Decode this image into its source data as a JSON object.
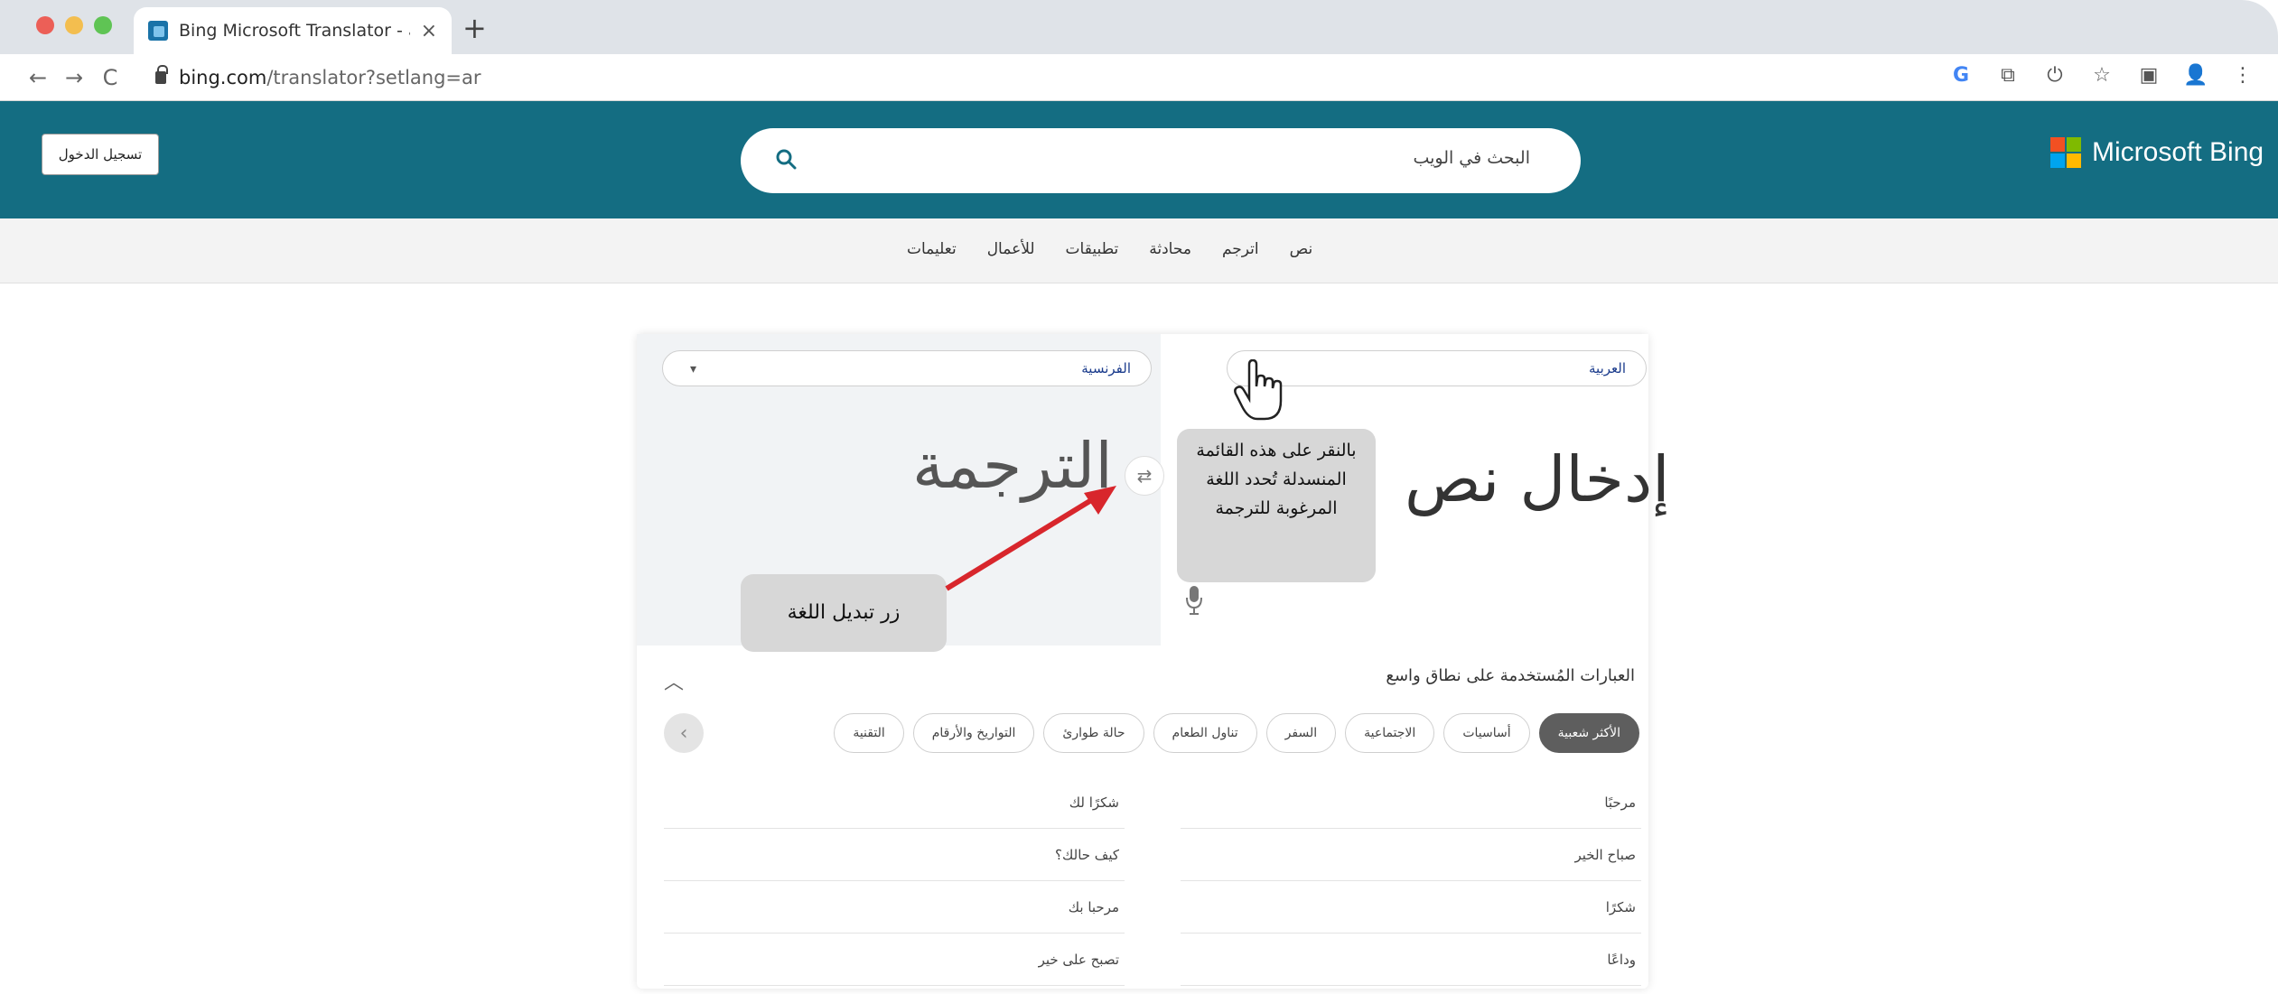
{
  "browser": {
    "tab_title": "Bing Microsoft Translator - عربية",
    "tab_close": "×",
    "new_tab": "+",
    "url_host": "bing.com",
    "url_rest": "/translator?setlang=ar",
    "nav": {
      "back": "←",
      "forward": "→",
      "reload": "C"
    },
    "toolbar_icons": [
      "G",
      "⧉",
      "⏻",
      "☆",
      "▣",
      "👤",
      "⋮"
    ]
  },
  "header": {
    "signin_label": "تسجيل الدخول",
    "search_placeholder": "البحث في الويب",
    "brand_name": "Microsoft Bing",
    "brand_colors": [
      "#f25022",
      "#7fba00",
      "#00a4ef",
      "#ffb900"
    ],
    "accent_color": "#146d82"
  },
  "subnav": {
    "items": [
      "نص",
      "اترجم",
      "محادثة",
      "تطبيقات",
      "للأعمال",
      "تعليمات"
    ]
  },
  "translator": {
    "source_lang": "العربية",
    "target_lang": "الفرنسية",
    "source_placeholder": "إدخال نص",
    "target_placeholder": "الترجمة",
    "swap_symbol": "⇄",
    "dropdown_symbol": "▾"
  },
  "callouts": {
    "dropdown_hint": "بالنقر على هذه القائمة المنسدلة تُحدد اللغة المرغوبة للترجمة",
    "swap_hint": "زر تبديل اللغة"
  },
  "phrases": {
    "title": "العبارات المُستخدمة على نطاق واسع",
    "collapse_symbol": "︿",
    "prev_symbol": "‹",
    "categories": [
      "الأكثر شعبية",
      "أساسيات",
      "الاجتماعية",
      "السفر",
      "تناول الطعام",
      "حالة طوارئ",
      "التواريخ والأرقام",
      "التقنية"
    ],
    "active_category": "الأكثر شعبية",
    "right_column": [
      "مرحبًا",
      "صباح الخير",
      "شكرًا",
      "وداعًا"
    ],
    "left_column": [
      "شكرًا لك",
      "كيف حالك؟",
      "مرحبا بك",
      "تصبح على خير"
    ]
  }
}
